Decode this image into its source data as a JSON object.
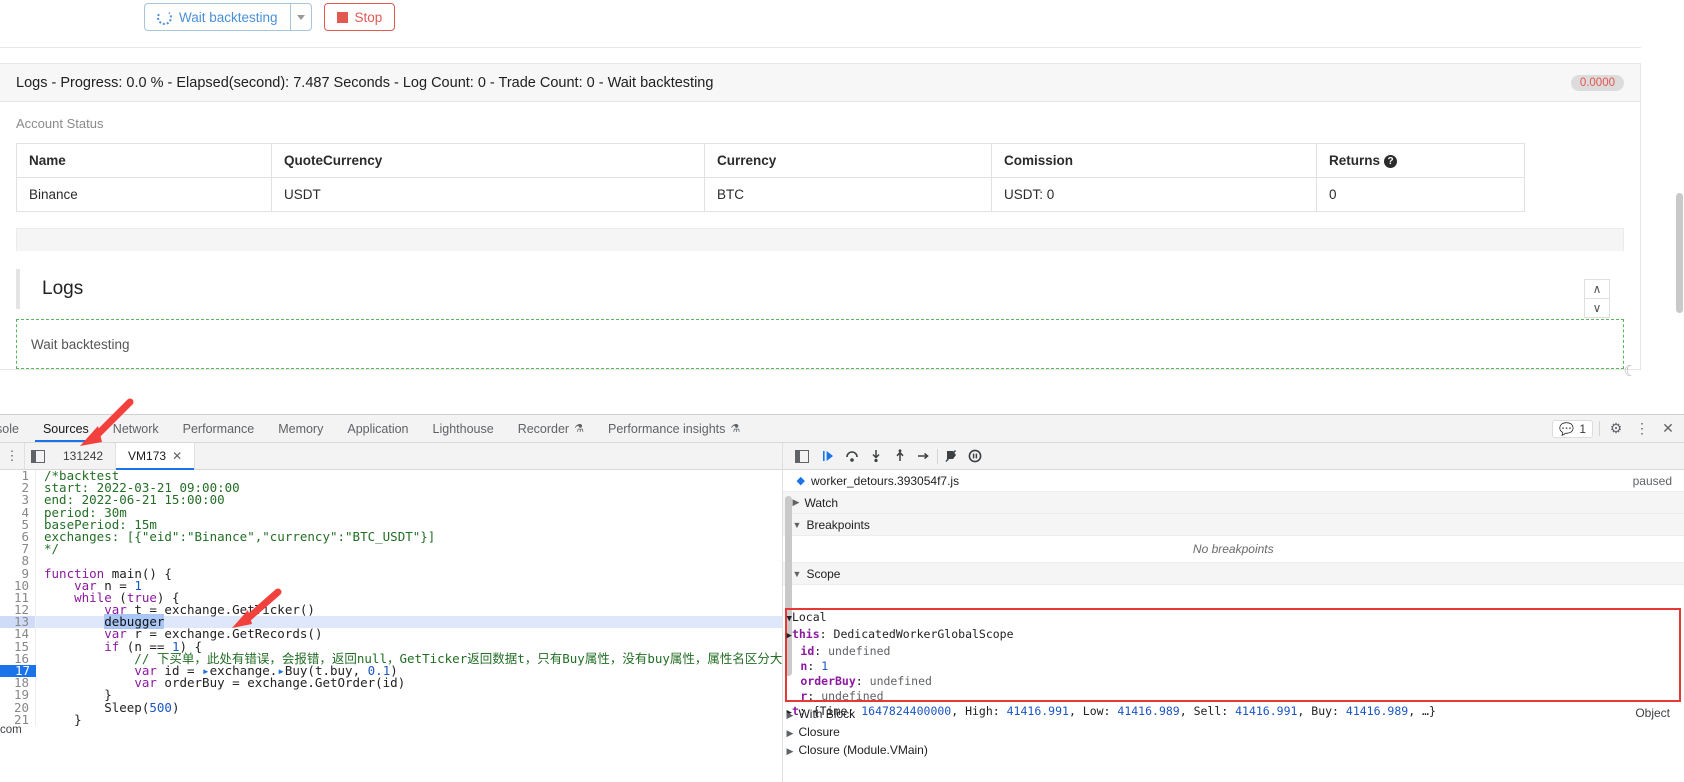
{
  "toolbar": {
    "wait_button": "Wait backtesting",
    "dropdown_icon": "chevron-down-icon",
    "stop_button": "Stop"
  },
  "logs_header": {
    "title": "Logs - Progress: 0.0 % - Elapsed(second): 7.487 Seconds - Log Count: 0 - Trade Count: 0 - Wait backtesting",
    "badge": "0.0000"
  },
  "account_status": {
    "label": "Account Status",
    "columns": [
      "Name",
      "QuoteCurrency",
      "Currency",
      "Comission",
      "Returns"
    ],
    "rows": [
      [
        "Binance",
        "USDT",
        "BTC",
        "USDT: 0",
        "0"
      ]
    ]
  },
  "logs_section": {
    "title": "Logs",
    "entry": "Wait backtesting",
    "scroll_up": "∧",
    "scroll_down": "∨",
    "theme_icon": "☾"
  },
  "devtools": {
    "tabs": [
      {
        "label": "sole",
        "active": false,
        "experimental": false
      },
      {
        "label": "Sources",
        "active": true,
        "experimental": false
      },
      {
        "label": "Network",
        "active": false,
        "experimental": false
      },
      {
        "label": "Performance",
        "active": false,
        "experimental": false
      },
      {
        "label": "Memory",
        "active": false,
        "experimental": false
      },
      {
        "label": "Application",
        "active": false,
        "experimental": false
      },
      {
        "label": "Lighthouse",
        "active": false,
        "experimental": false
      },
      {
        "label": "Recorder",
        "active": false,
        "experimental": true
      },
      {
        "label": "Performance insights",
        "active": false,
        "experimental": true
      }
    ],
    "message_count": "1",
    "settings_icon": "gear-icon",
    "more_icon": "kebab-menu-icon",
    "close_icon": "close-icon",
    "file_tabs": [
      {
        "label": "131242",
        "active": false,
        "closable": false
      },
      {
        "label": "VM173",
        "active": true,
        "closable": true
      }
    ],
    "debug_buttons": [
      "resume-script-execution",
      "step-over-next-function-call",
      "step-into-next-function-call",
      "step-out-of-current-function",
      "step",
      "deactivate-breakpoints",
      "pause-on-exceptions"
    ],
    "paused_label": "paused",
    "call_stack_file": "worker_detours.393054f7.js",
    "sections": {
      "watch": "Watch",
      "breakpoints": "Breakpoints",
      "no_breakpoints": "No breakpoints",
      "scope": "Scope"
    },
    "scope": {
      "local_label": "Local",
      "entries": [
        {
          "expandable": true,
          "name": "this",
          "value": "DedicatedWorkerGlobalScope",
          "kind": "obj"
        },
        {
          "expandable": false,
          "name": "id",
          "value": "undefined",
          "kind": "und"
        },
        {
          "expandable": false,
          "name": "n",
          "value": "1",
          "kind": "num"
        },
        {
          "expandable": false,
          "name": "orderBuy",
          "value": "undefined",
          "kind": "und"
        },
        {
          "expandable": false,
          "name": "r",
          "value": "undefined",
          "kind": "und"
        },
        {
          "expandable": true,
          "name": "t",
          "value": "{Time: 1647824400000, High: 41416.991, Low: 41416.989, Sell: 41416.991, Buy: 41416.989, …}",
          "kind": "obj"
        }
      ],
      "trailing": [
        "With Block",
        "Closure",
        "Closure (Module.VMain)"
      ],
      "object_label": "Object"
    },
    "editor": {
      "lines": [
        {
          "n": "1",
          "text": "/*backtest",
          "style": "comment"
        },
        {
          "n": "2",
          "text": "start: 2022-03-21 09:00:00",
          "style": "comment"
        },
        {
          "n": "3",
          "text": "end: 2022-06-21 15:00:00",
          "style": "comment"
        },
        {
          "n": "4",
          "text": "period: 30m",
          "style": "comment"
        },
        {
          "n": "5",
          "text": "basePeriod: 15m",
          "style": "comment"
        },
        {
          "n": "6",
          "text": "exchanges: [{\"eid\":\"Binance\",\"currency\":\"BTC_USDT\"}]",
          "style": "comment"
        },
        {
          "n": "7",
          "text": "*/",
          "style": "comment"
        },
        {
          "n": "8",
          "text": "",
          "style": "plain"
        },
        {
          "n": "9",
          "text": "function main() {",
          "style": "code"
        },
        {
          "n": "10",
          "text": "    var n = 1",
          "style": "code"
        },
        {
          "n": "11",
          "text": "    while (true) {",
          "style": "code"
        },
        {
          "n": "12",
          "text": "        var t = exchange.GetTicker()",
          "style": "code"
        },
        {
          "n": "13",
          "text": "        debugger",
          "style": "selected"
        },
        {
          "n": "14",
          "text": "        var r = exchange.GetRecords()",
          "style": "code"
        },
        {
          "n": "15",
          "text": "        if (n == 1) {",
          "style": "code"
        },
        {
          "n": "16",
          "text": "            // 下买单，此处有错误，会报错，返回null，GetTicker返回数据t，只有Buy属性，没有buy属性，属性名区分大小写",
          "style": "comment"
        },
        {
          "n": "17",
          "text": "            var id = exchange.Buy(t.buy, 0.1)",
          "style": "breakpoint"
        },
        {
          "n": "18",
          "text": "            var orderBuy = exchange.GetOrder(id)",
          "style": "code"
        },
        {
          "n": "19",
          "text": "        }",
          "style": "code"
        },
        {
          "n": "20",
          "text": "        Sleep(500)",
          "style": "code"
        },
        {
          "n": "21",
          "text": "    }",
          "style": "code"
        }
      ],
      "edge_text": "com"
    }
  }
}
